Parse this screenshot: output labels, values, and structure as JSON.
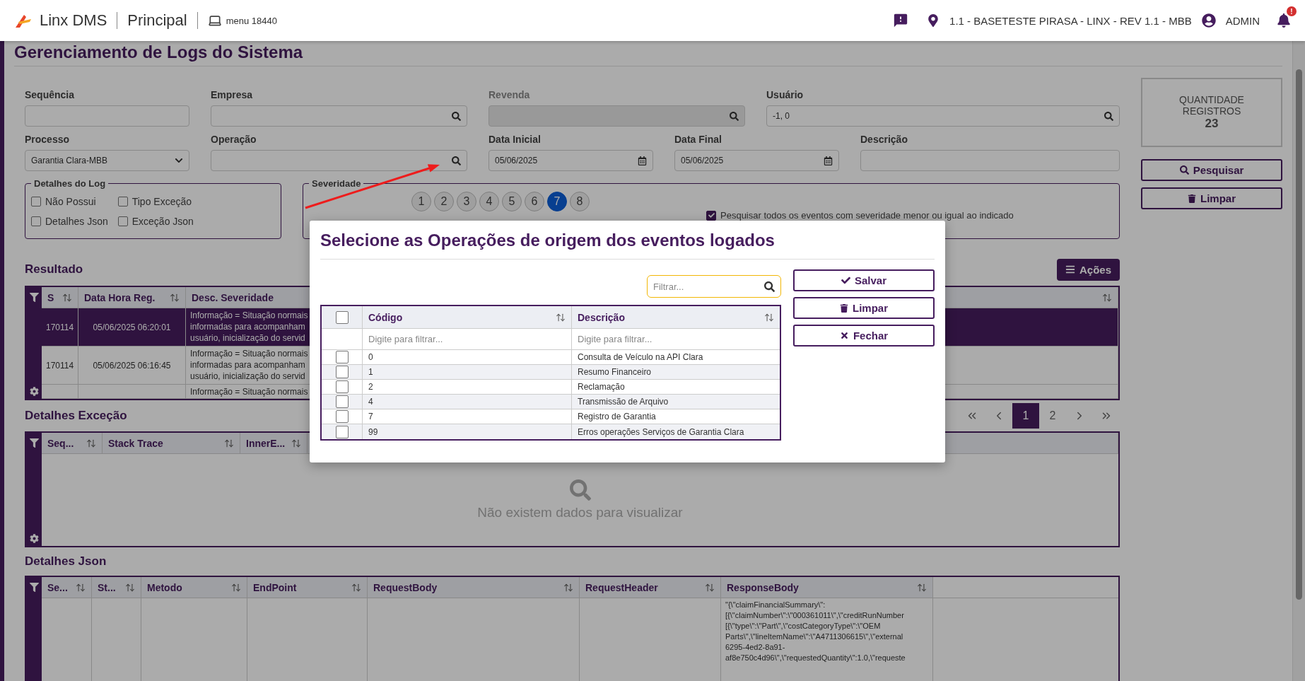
{
  "header": {
    "brand": "Linx DMS",
    "module": "Principal",
    "menu": "menu 18440",
    "location": "1.1 - BASETESTE PIRASA - LINX - REV 1.1 - MBB",
    "user": "ADMIN",
    "notification_badge": "!"
  },
  "page_title": "Gerenciamento de Logs do Sistema",
  "form_rows": [
    [
      {
        "label": "Sequência",
        "kind": "text",
        "disabled": false
      },
      {
        "label": "Empresa",
        "kind": "search",
        "disabled": false
      },
      {
        "label": "Revenda",
        "kind": "search",
        "disabled": true
      },
      {
        "label": "Usuário",
        "kind": "search",
        "disabled": false,
        "value": "-1, 0"
      }
    ],
    [
      {
        "label": "Processo",
        "kind": "select",
        "disabled": false,
        "value": "Garantia Clara-MBB"
      },
      {
        "label": "Operação",
        "kind": "search",
        "disabled": false
      },
      {
        "label": "Data Inicial",
        "kind": "date",
        "disabled": false,
        "value": "05/06/2025"
      },
      {
        "label": "Data Final",
        "kind": "date",
        "disabled": false,
        "value": "05/06/2025"
      },
      {
        "label": "Descrição",
        "kind": "text",
        "disabled": false
      }
    ]
  ],
  "log_details": {
    "title": "Detalhes do Log",
    "options": [
      {
        "label": "Não Possui",
        "checked": false
      },
      {
        "label": "Tipo Exceção",
        "checked": false
      },
      {
        "label": "Detalhes Json",
        "checked": false
      },
      {
        "label": "Exceção Json",
        "checked": false
      }
    ]
  },
  "severity": {
    "title": "Severidade",
    "levels": [
      {
        "label": "1",
        "selected": false
      },
      {
        "label": "2",
        "selected": false
      },
      {
        "label": "3",
        "selected": false
      },
      {
        "label": "4",
        "selected": false
      },
      {
        "label": "5",
        "selected": false
      },
      {
        "label": "6",
        "selected": false
      },
      {
        "label": "7",
        "selected": true
      },
      {
        "label": "8",
        "selected": false
      }
    ],
    "option": {
      "label": "Pesquisar todos os eventos com severidade menor ou igual ao indicado",
      "checked": true
    }
  },
  "summary": {
    "label": "QUANTIDADE REGISTROS",
    "count": "23"
  },
  "side_buttons": [
    {
      "label": "Pesquisar",
      "kind": "search"
    },
    {
      "label": "Limpar",
      "kind": "trash"
    }
  ],
  "result": {
    "title": "Resultado",
    "actions_button": "Ações",
    "columns": [
      "S",
      "Data Hora Reg.",
      "Desc. Severidade"
    ],
    "rows": [
      {
        "seq": "170114",
        "datetime": "05/06/2025 06:20:01",
        "description": "Informação = Situação normais\ninformadas para acompanham\nusuário, inicialização do servid",
        "selected": true
      },
      {
        "seq": "170114",
        "datetime": "05/06/2025 06:16:45",
        "description": "Informação = Situação normais\ninformadas para acompanham\nusuário, inicialização do servid",
        "selected": false
      },
      {
        "description": "Informação = Situação normais",
        "selected": false
      }
    ]
  },
  "pagination": {
    "pages": [
      {
        "label": "1",
        "selected": true
      },
      {
        "label": "2",
        "selected": false
      }
    ]
  },
  "exception": {
    "title": "Detalhes Exceção",
    "columns": [
      "Seq...",
      "Stack Trace",
      "InnerE..."
    ],
    "empty_message": "Não existem dados para visualizar"
  },
  "json_details": {
    "title": "Detalhes Json",
    "columns": [
      "Se...",
      "St...",
      "Metodo",
      "EndPoint",
      "RequestBody",
      "RequestHeader",
      "ResponseBody"
    ],
    "response_body": "\"{\\\"claimFinancialSummary\\\":\n[{\\\"claimNumber\\\":\\\"000361011\\\",\\\"creditRunNumber\n[{\\\"type\\\":\\\"Part\\\",\\\"costCategoryType\\\":\\\"OEM\nParts\\\",\\\"lineItemName\\\":\\\"A4711306615\\\",\\\"external\n6295-4ed2-8a91-\naf8e750c4d96\\\",\\\"requestedQuantity\\\":1.0,\\\"requeste"
  },
  "modal": {
    "title": "Selecione as Operações de origem dos eventos logados",
    "filter_placeholder": "Filtrar...",
    "select_all_checked": false,
    "columns": [
      {
        "label": "Código",
        "filter_placeholder": "Digite para filtrar..."
      },
      {
        "label": "Descrição",
        "filter_placeholder": "Digite para filtrar..."
      }
    ],
    "rows": [
      {
        "code": "0",
        "description": "Consulta de Veículo na API Clara",
        "checked": false
      },
      {
        "code": "1",
        "description": "Resumo Financeiro",
        "checked": false
      },
      {
        "code": "2",
        "description": "Reclamação",
        "checked": false
      },
      {
        "code": "4",
        "description": "Transmissão de Arquivo",
        "checked": false
      },
      {
        "code": "7",
        "description": "Registro de Garantia",
        "checked": false
      },
      {
        "code": "99",
        "description": "Erros operações Serviços de Garantia Clara",
        "checked": false
      }
    ],
    "buttons": [
      {
        "label": "Salvar",
        "kind": "check"
      },
      {
        "label": "Limpar",
        "kind": "trash"
      },
      {
        "label": "Fechar",
        "kind": "close"
      }
    ]
  },
  "annotation": {
    "kind": "arrow"
  }
}
